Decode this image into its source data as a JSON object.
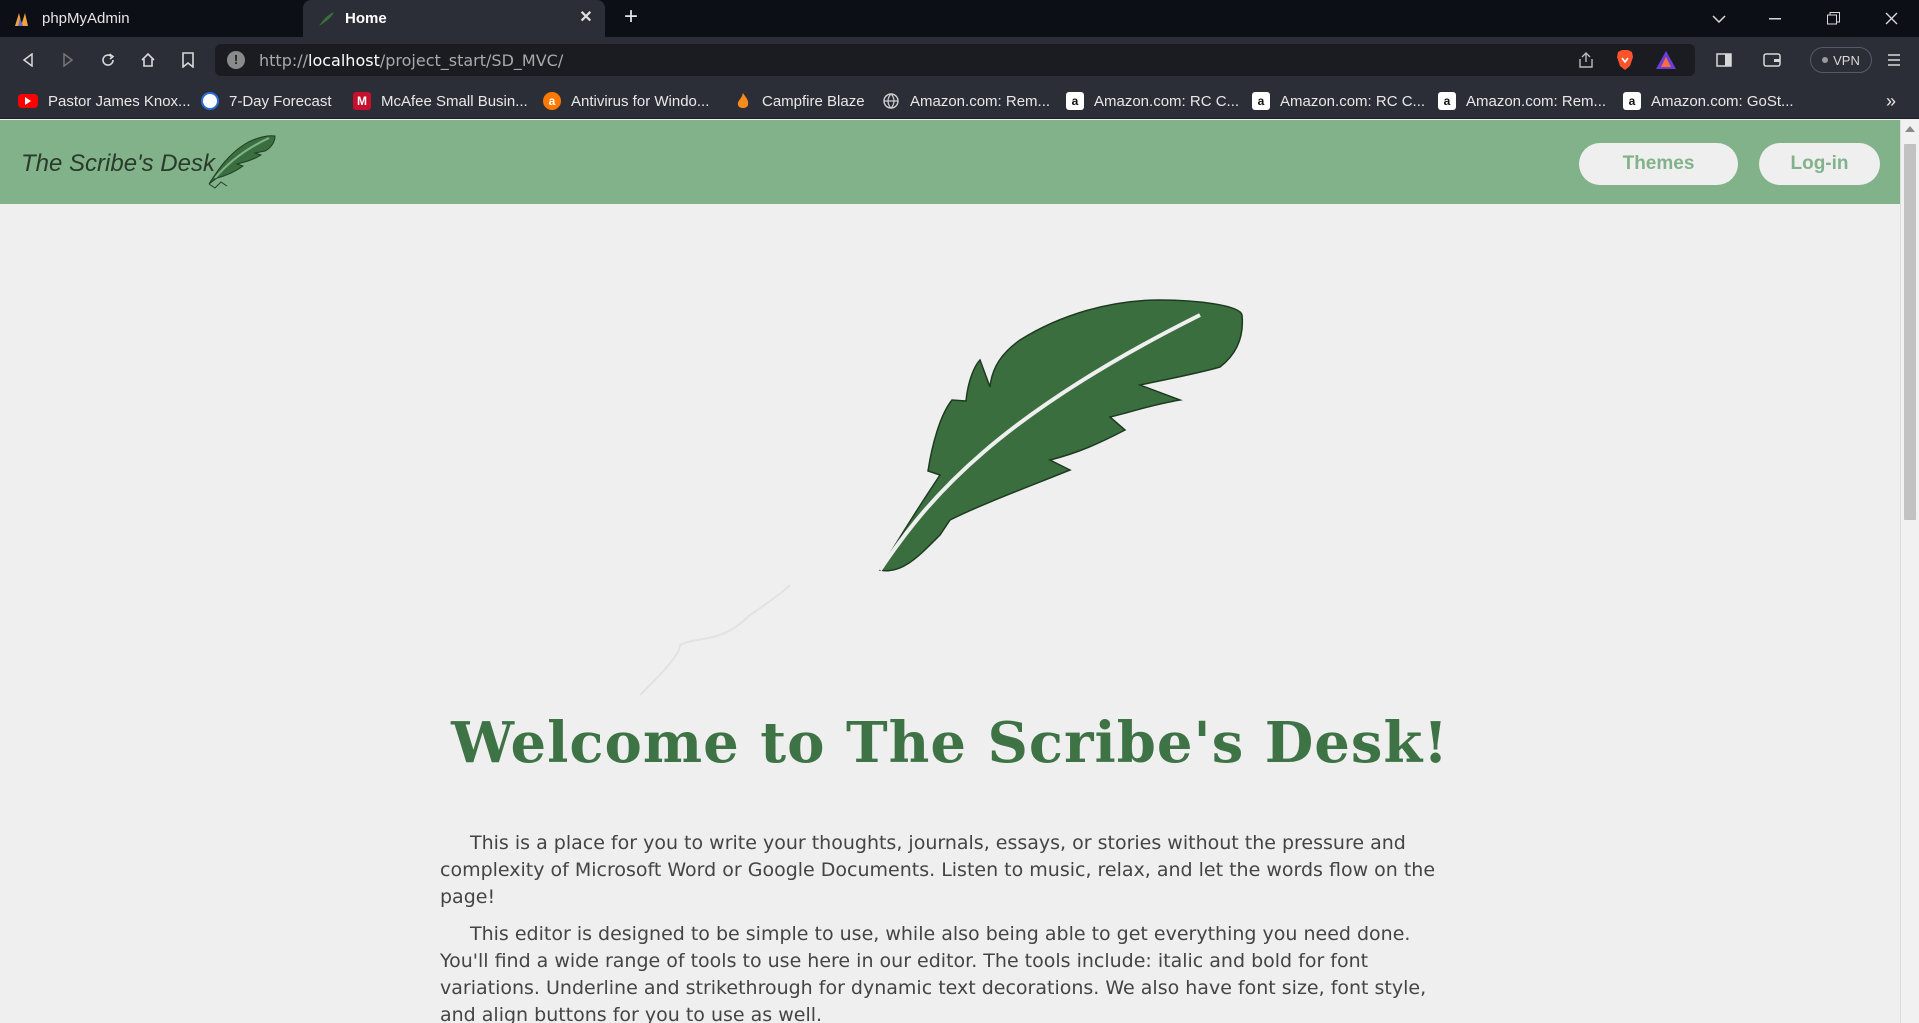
{
  "browser": {
    "tabs": [
      {
        "title": "phpMyAdmin",
        "active": false
      },
      {
        "title": "Home",
        "active": true
      }
    ],
    "new_tab": "+",
    "address": {
      "scheme": "http://",
      "host": "localhost",
      "path": "/project_start/SD_MVC/"
    },
    "vpn_label": "VPN",
    "bookmarks": [
      {
        "label": "Pastor James Knox...",
        "icon": "youtube-icon"
      },
      {
        "label": "7-Day Forecast",
        "icon": "weather-icon"
      },
      {
        "label": "McAfee Small Busin...",
        "icon": "mcafee-icon"
      },
      {
        "label": "Antivirus for Windo...",
        "icon": "avast-icon"
      },
      {
        "label": "Campfire Blaze",
        "icon": "flame-icon"
      },
      {
        "label": "Amazon.com: Rem...",
        "icon": "globe-icon"
      },
      {
        "label": "Amazon.com: RC C...",
        "icon": "amazon-icon"
      },
      {
        "label": "Amazon.com: RC C...",
        "icon": "amazon-icon"
      },
      {
        "label": "Amazon.com: Rem...",
        "icon": "amazon-icon"
      },
      {
        "label": "Amazon.com: GoSt...",
        "icon": "amazon-icon"
      }
    ],
    "bookmarks_more": "»"
  },
  "site": {
    "brand": "The Scribe's Desk",
    "nav": {
      "themes": "Themes",
      "login": "Log-in"
    },
    "welcome": "Welcome to The Scribe's Desk!",
    "paragraphs": [
      "This is a place for you to write your thoughts, journals, essays, or stories without the pressure and complexity of Microsoft Word or Google Documents. Listen to music, relax, and let the words flow on the page!",
      "This editor is designed to be simple to use, while also being able to get everything you need done. You'll find a wide range of tools to use here in our editor. The tools include: italic and bold for font variations. Underline and strikethrough for dynamic text decorations. We also have font size, font style, and align buttons for you to use as well."
    ]
  },
  "colors": {
    "header": "#82b28a",
    "accent": "#3e7345",
    "feather": "#3a6e3f",
    "page_bg": "#efefef"
  }
}
